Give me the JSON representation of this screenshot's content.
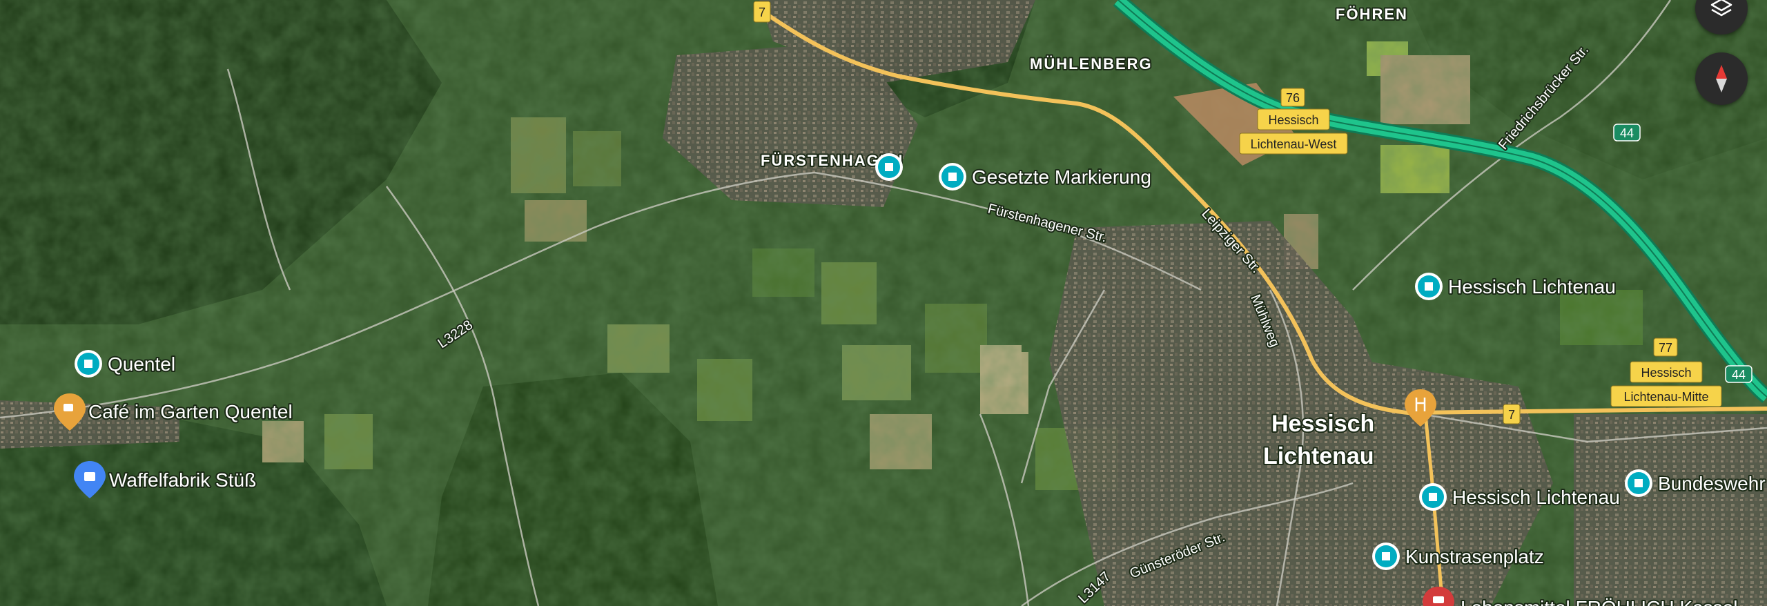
{
  "map": {
    "type": "satellite",
    "areas": [
      "FÖHREN",
      "MÜHLENBERG",
      "FÜRSTENHAGEN"
    ],
    "city": [
      "Hessisch",
      "Lichtenau"
    ],
    "pois": [
      {
        "label": "Gesetzte Markierung",
        "icon": "bookmark-icon",
        "color": "#00acc1"
      },
      {
        "label": "Hessisch Lichtenau",
        "icon": "bookmark-icon",
        "color": "#00acc1"
      },
      {
        "label": "Quentel",
        "icon": "bookmark-icon",
        "color": "#00acc1"
      },
      {
        "label": "Café im Garten Quentel",
        "icon": "cafe-icon",
        "color": "#e8a33b"
      },
      {
        "label": "Waffelfabrik Stüß",
        "icon": "shopping-bag-icon",
        "color": "#4285f4"
      },
      {
        "label": "Hessisch Lichtenau",
        "icon": "bookmark-icon",
        "color": "#00acc1"
      },
      {
        "label": "Bundeswehr",
        "icon": "bookmark-icon",
        "color": "#00acc1"
      },
      {
        "label": "Kunstrasenplatz",
        "icon": "bookmark-icon",
        "color": "#00acc1"
      },
      {
        "label": "Lebensmittel FRÖHLICH Kassel",
        "icon": "shop-icon",
        "color": "#d33b3b"
      }
    ],
    "streets": [
      "Fürstenhagener Str.",
      "Leipziger Str.",
      "Mühlweg",
      "L3228",
      "Friedrichsbrücker Str.",
      "Günsteröder Str.",
      "L3147"
    ],
    "shields": {
      "b7_top": "7",
      "b7_right": "7",
      "a44_a": "44",
      "a44_b": "44",
      "exit_76": "76",
      "exit_77": "77"
    },
    "exits": [
      {
        "line1": "Hessisch",
        "line2": "Lichtenau-West"
      },
      {
        "line1": "Hessisch",
        "line2": "Lichtenau-Mitte"
      }
    ],
    "colors": {
      "motorway": "#1fc48c",
      "federal_road": "#f3c25a",
      "shield_yellow": "#f6d34a",
      "poi_teal": "#00acc1"
    }
  },
  "controls": {
    "layers_icon": "layers-icon",
    "compass_icon": "compass-icon"
  }
}
